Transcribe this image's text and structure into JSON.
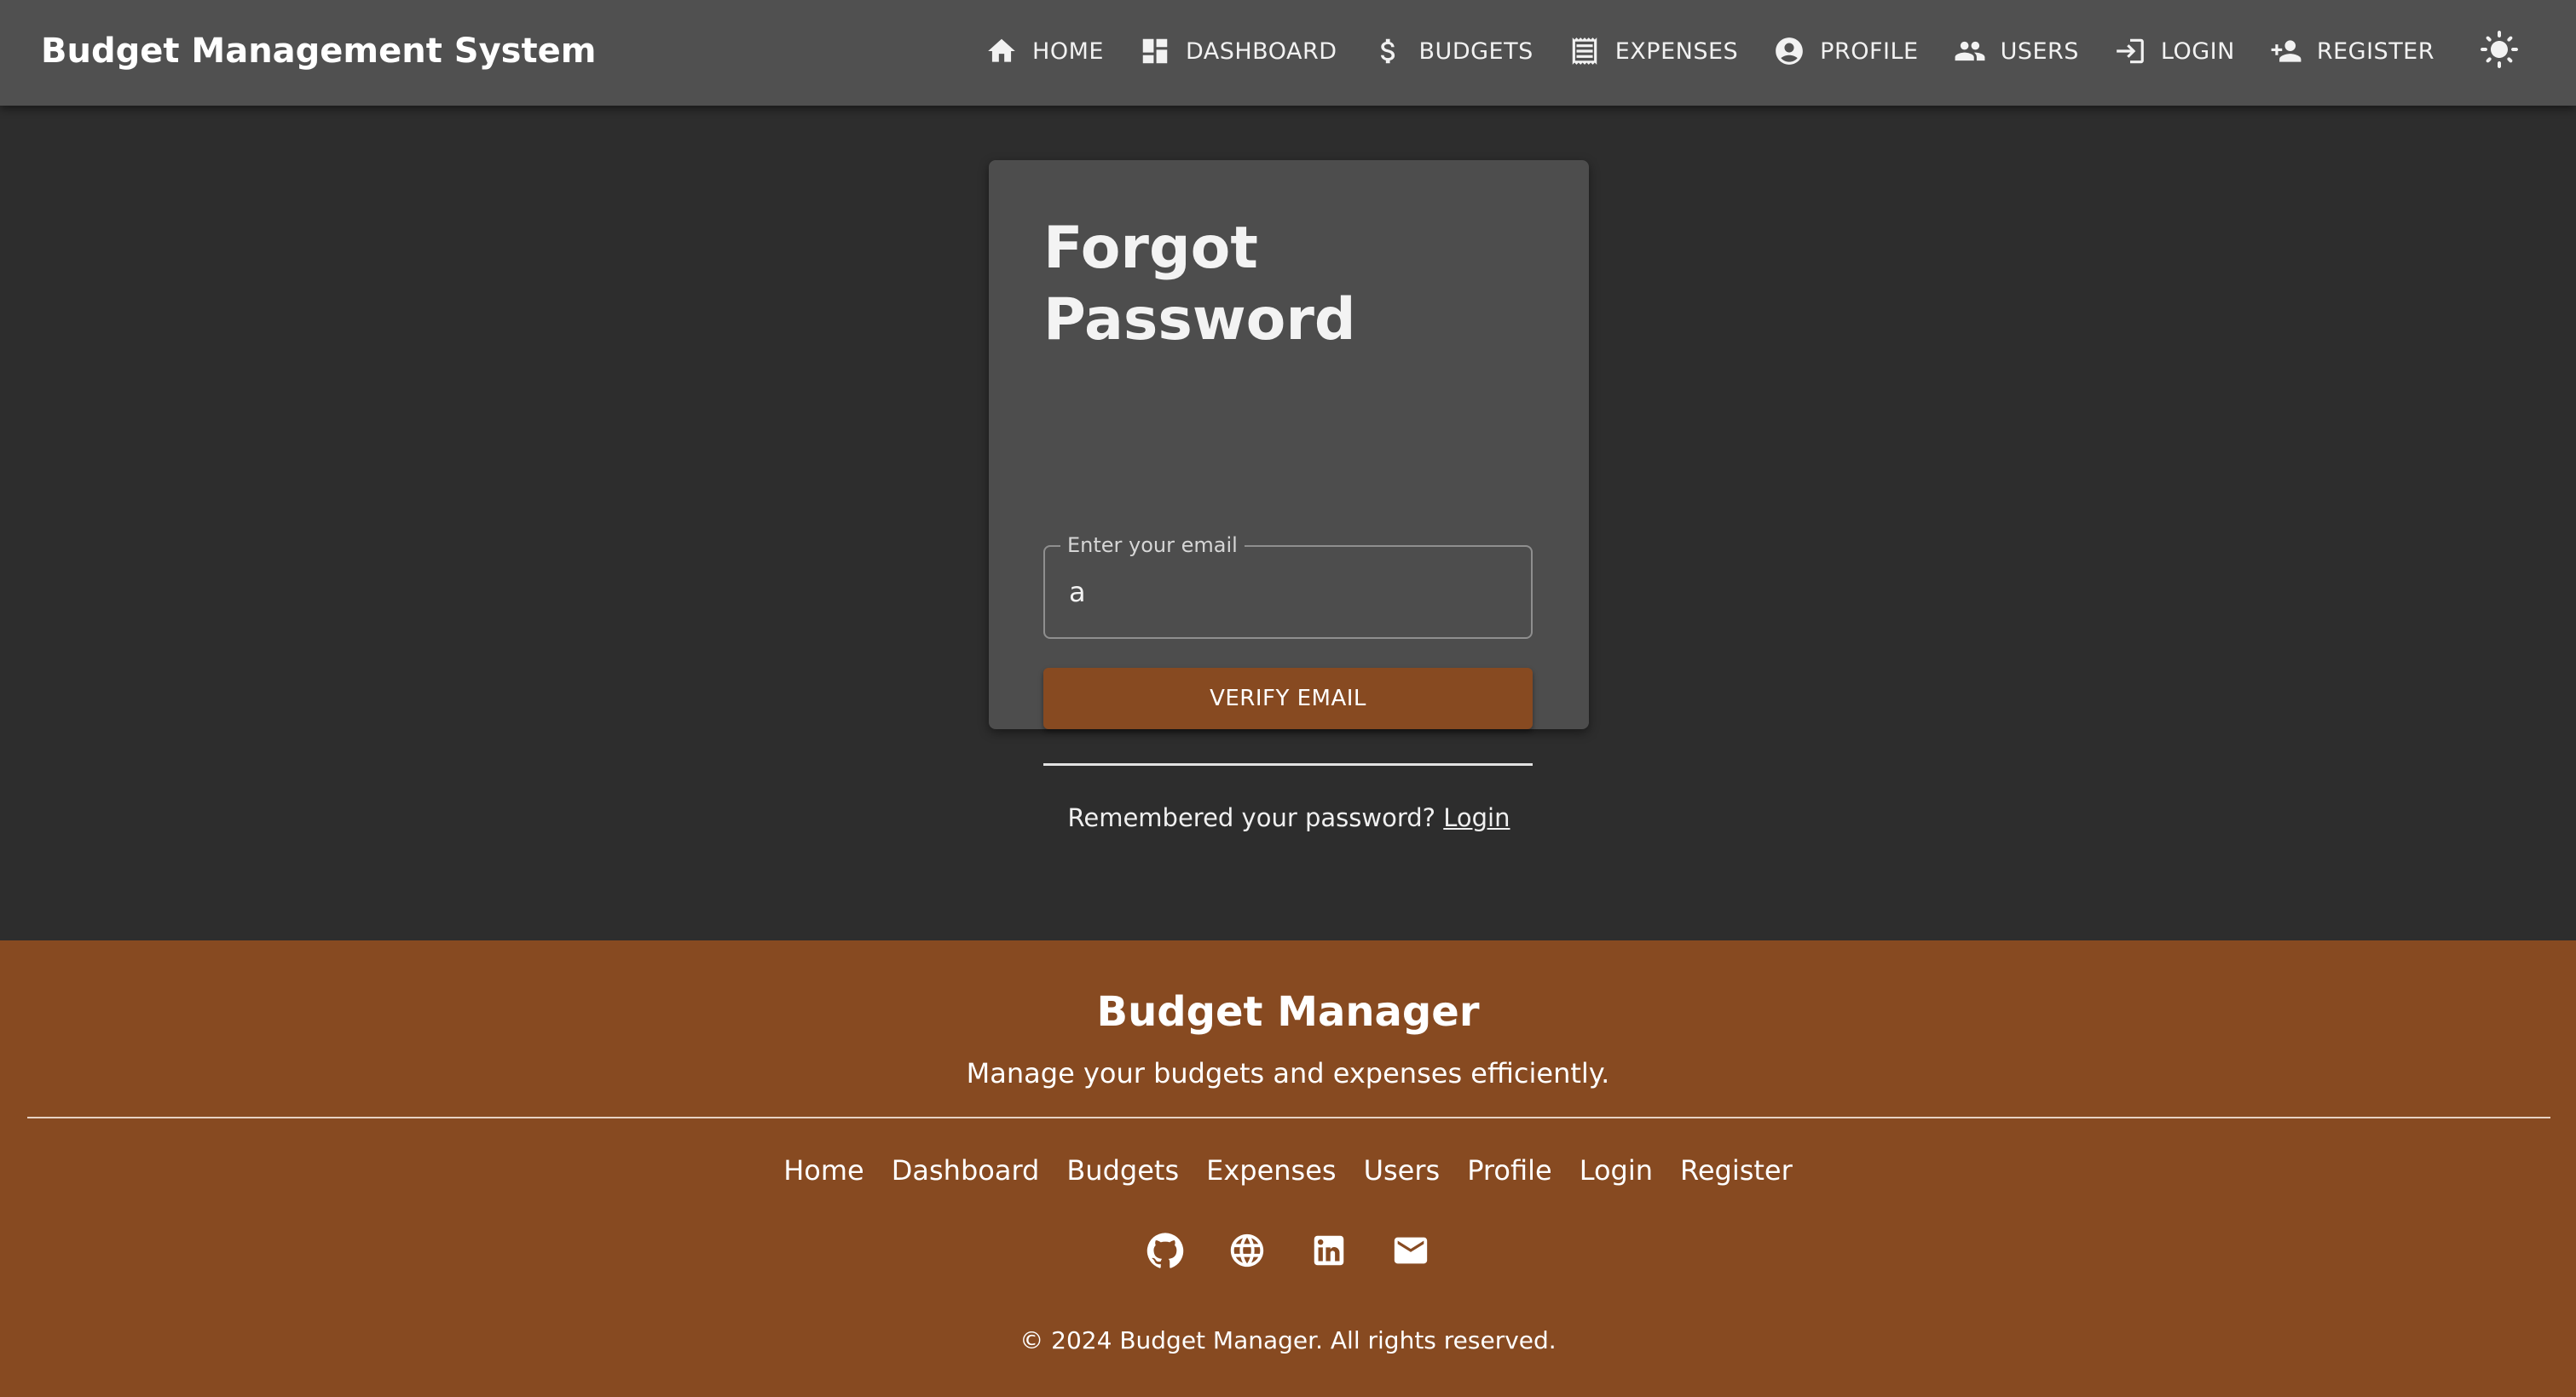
{
  "header": {
    "title": "Budget Management System",
    "nav": [
      {
        "label": "HOME",
        "icon": "home-icon"
      },
      {
        "label": "DASHBOARD",
        "icon": "dashboard-icon"
      },
      {
        "label": "BUDGETS",
        "icon": "dollar-icon"
      },
      {
        "label": "EXPENSES",
        "icon": "receipt-icon"
      },
      {
        "label": "PROFILE",
        "icon": "account-circle-icon"
      },
      {
        "label": "USERS",
        "icon": "people-icon"
      },
      {
        "label": "LOGIN",
        "icon": "login-icon"
      },
      {
        "label": "REGISTER",
        "icon": "person-add-icon"
      }
    ],
    "theme_toggle_icon": "sun-icon"
  },
  "card": {
    "title": "Forgot Password",
    "email_label": "Enter your email",
    "email_value": "a",
    "button_label": "VERIFY EMAIL",
    "remember_text": "Remembered your password?",
    "login_link": "Login"
  },
  "footer": {
    "title": "Budget Manager",
    "tagline": "Manage your budgets and expenses efficiently.",
    "links": [
      "Home",
      "Dashboard",
      "Budgets",
      "Expenses",
      "Users",
      "Profile",
      "Login",
      "Register"
    ],
    "social_icons": [
      "github-icon",
      "globe-icon",
      "linkedin-icon",
      "email-icon"
    ],
    "copyright": "© 2024 Budget Manager. All rights reserved."
  },
  "colors": {
    "header_bg": "#505050",
    "page_bg": "#2d2d2d",
    "card_bg": "#4d4d4d",
    "accent": "#874a21"
  }
}
